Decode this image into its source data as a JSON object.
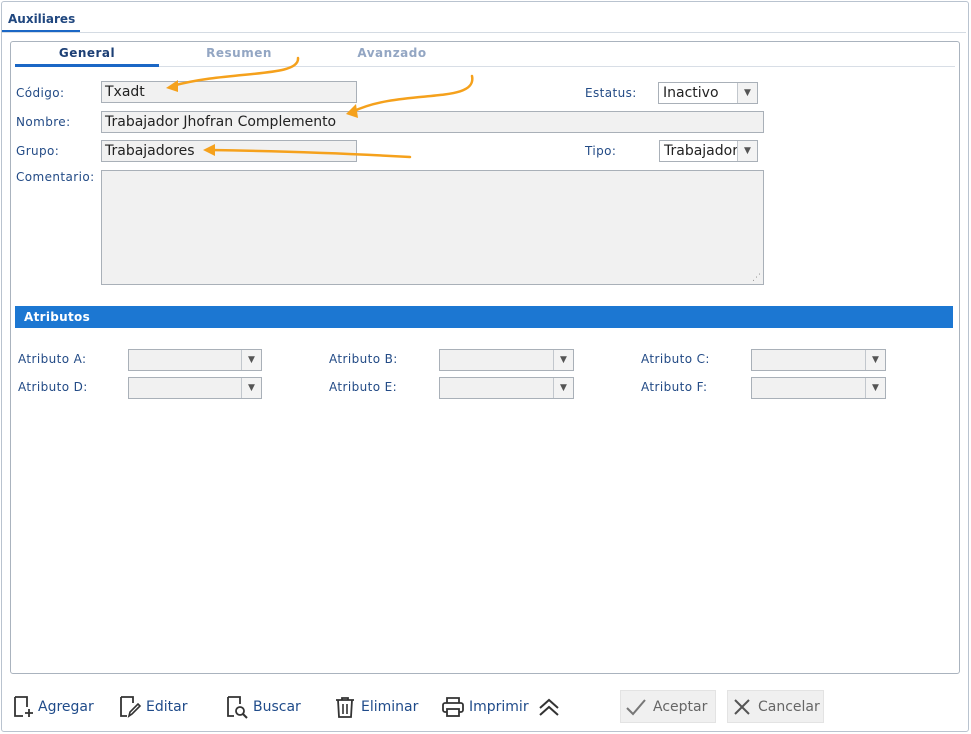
{
  "window": {
    "tab_label": "Auxiliares"
  },
  "tabs": [
    {
      "label": "General",
      "active": true
    },
    {
      "label": "Resumen",
      "active": false
    },
    {
      "label": "Avanzado",
      "active": false
    }
  ],
  "form": {
    "codigo_label": "Código:",
    "codigo_value": "Txadt",
    "nombre_label": "Nombre:",
    "nombre_value": "Trabajador Jhofran Complemento",
    "grupo_label": "Grupo:",
    "grupo_value": "Trabajadores",
    "comentario_label": "Comentario:",
    "comentario_value": "",
    "estatus_label": "Estatus:",
    "estatus_value": "Inactivo",
    "tipo_label": "Tipo:",
    "tipo_value": "Trabajador"
  },
  "atributos": {
    "title": "Atributos",
    "labels": [
      "Atributo A:",
      "Atributo B:",
      "Atributo C:",
      "Atributo D:",
      "Atributo E:",
      "Atributo F:"
    ]
  },
  "toolbar": {
    "agregar": "Agregar",
    "editar": "Editar",
    "buscar": "Buscar",
    "eliminar": "Eliminar",
    "imprimir": "Imprimir",
    "aceptar": "Aceptar",
    "cancelar": "Cancelar"
  },
  "colors": {
    "accent": "#1c77d2",
    "annotation_arrow": "#f5a11c",
    "label_text": "#234b86"
  },
  "icons": [
    "add-icon",
    "edit-icon",
    "search-icon",
    "trash-icon",
    "printer-icon",
    "double-chevron-up-icon",
    "check-icon",
    "close-icon",
    "dropdown-arrow-icon"
  ]
}
